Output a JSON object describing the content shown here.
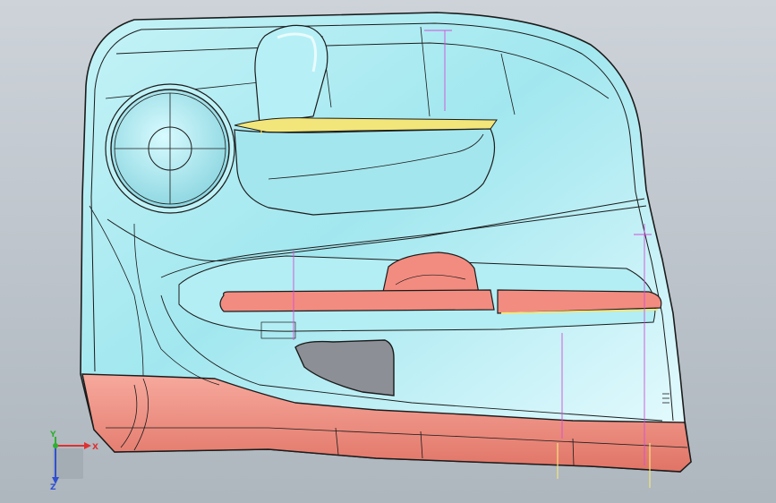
{
  "viewport": {
    "background_top": "#cdd3d9",
    "background_bottom": "#aeb6be"
  },
  "model": {
    "body_color": "#9fe7ef",
    "lower_trim_color": "#f28c80",
    "armrest_color": "#f28c80",
    "highlight_color": "#f2e67a",
    "edge_color": "#1b1b1b",
    "sketch_line_color": "#d24fd6"
  },
  "triad": {
    "x_label": "X",
    "y_label": "Y",
    "z_label": "Z",
    "x_color": "#e03030",
    "y_color": "#30b030",
    "z_color": "#3050d0"
  }
}
